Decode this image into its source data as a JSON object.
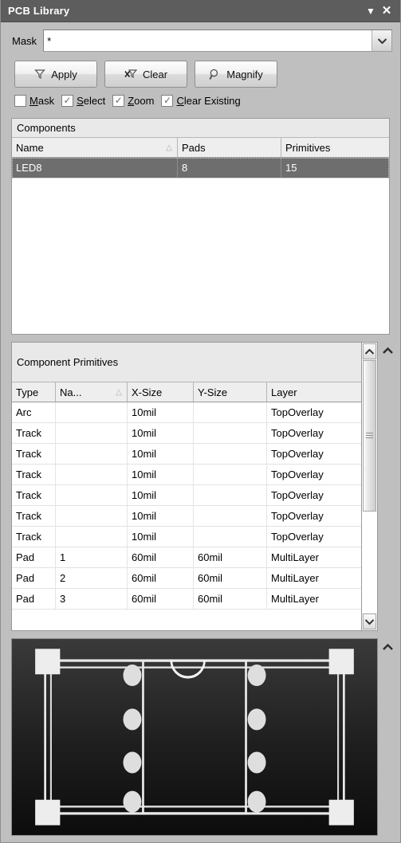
{
  "titlebar": {
    "title": "PCB Library",
    "caret_icon": "▼",
    "close_icon": "✕"
  },
  "mask": {
    "label": "Mask",
    "value": "*",
    "placeholder": "",
    "dropdown_icon": "chevron-down-icon"
  },
  "buttons": [
    {
      "label": "Apply",
      "icon": "filter-funnel-icon"
    },
    {
      "label": "Clear",
      "icon": "filter-clear-icon"
    },
    {
      "label": "Magnify",
      "icon": "magnifier-icon"
    }
  ],
  "checkboxes": [
    {
      "label": "Mask",
      "accel": "M",
      "rest": "ask",
      "checked": false
    },
    {
      "label": "Select",
      "accel": "S",
      "rest": "elect",
      "checked": true
    },
    {
      "label": "Zoom",
      "accel": "Z",
      "rest": "oom",
      "checked": true
    },
    {
      "label": "Clear Existing",
      "accel": "C",
      "rest": "lear Existing",
      "checked": true
    }
  ],
  "components": {
    "caption": "Components",
    "columns": [
      "Name",
      "Pads",
      "Primitives"
    ],
    "sorted_column": "Name",
    "sort_indicator": "△",
    "rows": [
      {
        "name": "LED8",
        "pads": "8",
        "primitives": "15",
        "selected": true
      }
    ]
  },
  "primitives": {
    "caption": "Component Primitives",
    "columns": [
      "Type",
      "Na...",
      "X-Size",
      "Y-Size",
      "Layer"
    ],
    "sorted_column": "Na...",
    "sort_indicator": "△",
    "rows": [
      {
        "type": "Arc",
        "name": "",
        "x": "10mil",
        "y": "",
        "layer": "TopOverlay"
      },
      {
        "type": "Track",
        "name": "",
        "x": "10mil",
        "y": "",
        "layer": "TopOverlay"
      },
      {
        "type": "Track",
        "name": "",
        "x": "10mil",
        "y": "",
        "layer": "TopOverlay"
      },
      {
        "type": "Track",
        "name": "",
        "x": "10mil",
        "y": "",
        "layer": "TopOverlay"
      },
      {
        "type": "Track",
        "name": "",
        "x": "10mil",
        "y": "",
        "layer": "TopOverlay"
      },
      {
        "type": "Track",
        "name": "",
        "x": "10mil",
        "y": "",
        "layer": "TopOverlay"
      },
      {
        "type": "Track",
        "name": "",
        "x": "10mil",
        "y": "",
        "layer": "TopOverlay"
      },
      {
        "type": "Pad",
        "name": "1",
        "x": "60mil",
        "y": "60mil",
        "layer": "MultiLayer"
      },
      {
        "type": "Pad",
        "name": "2",
        "x": "60mil",
        "y": "60mil",
        "layer": "MultiLayer"
      },
      {
        "type": "Pad",
        "name": "3",
        "x": "60mil",
        "y": "60mil",
        "layer": "MultiLayer"
      }
    ],
    "scrollbar": {
      "up_icon": "chevron-up-icon",
      "down_icon": "chevron-down-icon"
    }
  },
  "collapse_icons": {
    "primitives": "chevron-up-icon",
    "preview": "chevron-up-icon",
    "glyph": "⌃"
  },
  "preview": {
    "name": "component-footprint-preview",
    "background": "#1c1c1c",
    "line_color": "#f0f0f0",
    "pad_color": "#e8e8e8"
  }
}
